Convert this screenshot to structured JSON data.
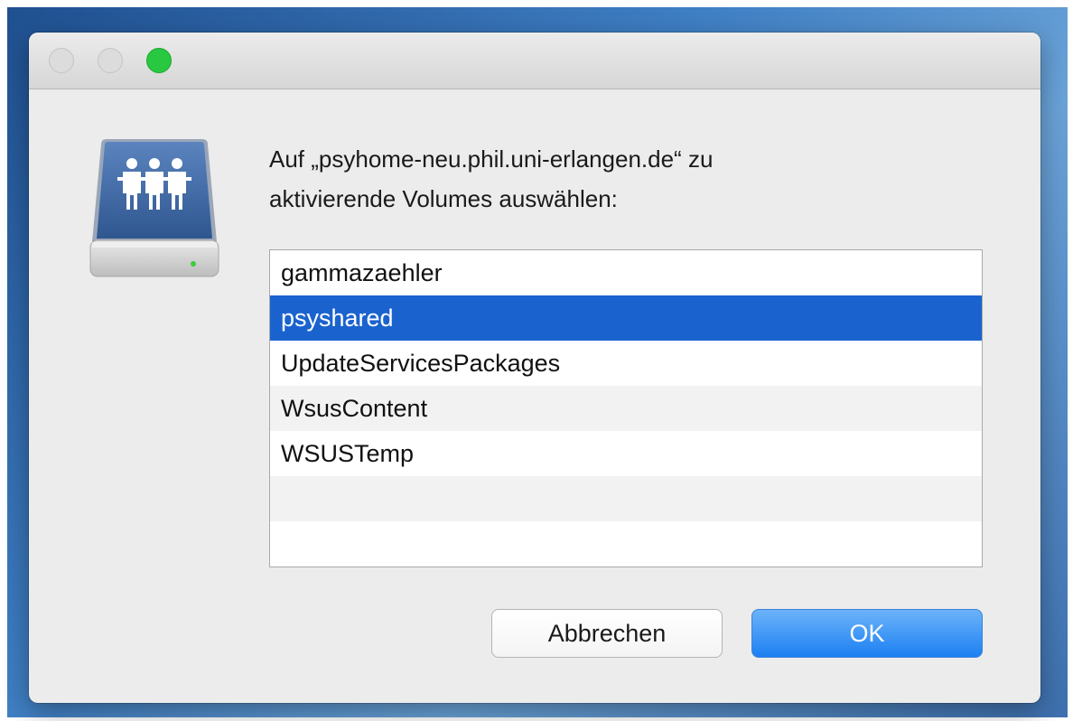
{
  "window": {
    "buttons": [
      "close",
      "minimize",
      "zoom"
    ]
  },
  "dialog": {
    "icon": "shared-server-icon",
    "message_line1": "Auf „psyhome-neu.phil.uni-erlangen.de“ zu",
    "message_line2": "aktivierende Volumes auswählen:"
  },
  "volumes": [
    {
      "label": "gammazaehler",
      "selected": false
    },
    {
      "label": "psyshared",
      "selected": true
    },
    {
      "label": "UpdateServicesPackages",
      "selected": false
    },
    {
      "label": "WsusContent",
      "selected": false
    },
    {
      "label": "WSUSTemp",
      "selected": false
    }
  ],
  "buttons": {
    "cancel_label": "Abbrechen",
    "ok_label": "OK"
  },
  "colors": {
    "selection": "#1a63cf",
    "ok_button": "#1c80f2",
    "zoom_button": "#28c840"
  }
}
